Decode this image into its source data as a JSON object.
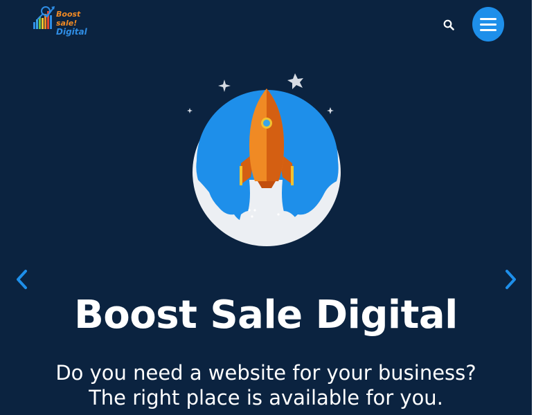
{
  "brand": {
    "logo_line1": "Boost sale!",
    "logo_line2": "Digital",
    "colors": {
      "background": "#0b2340",
      "accent_blue": "#1e8fea",
      "accent_orange": "#f08a24"
    }
  },
  "header": {
    "search_icon": "search-icon",
    "menu_icon": "hamburger-menu-icon"
  },
  "hero": {
    "illustration": "rocket-launch-illustration",
    "title": "Boost Sale Digital",
    "subtitle_line1": "Do you need a website for your business?",
    "subtitle_line2": "The right place is available for you."
  },
  "carousel": {
    "prev_icon": "chevron-left-icon",
    "next_icon": "chevron-right-icon"
  }
}
